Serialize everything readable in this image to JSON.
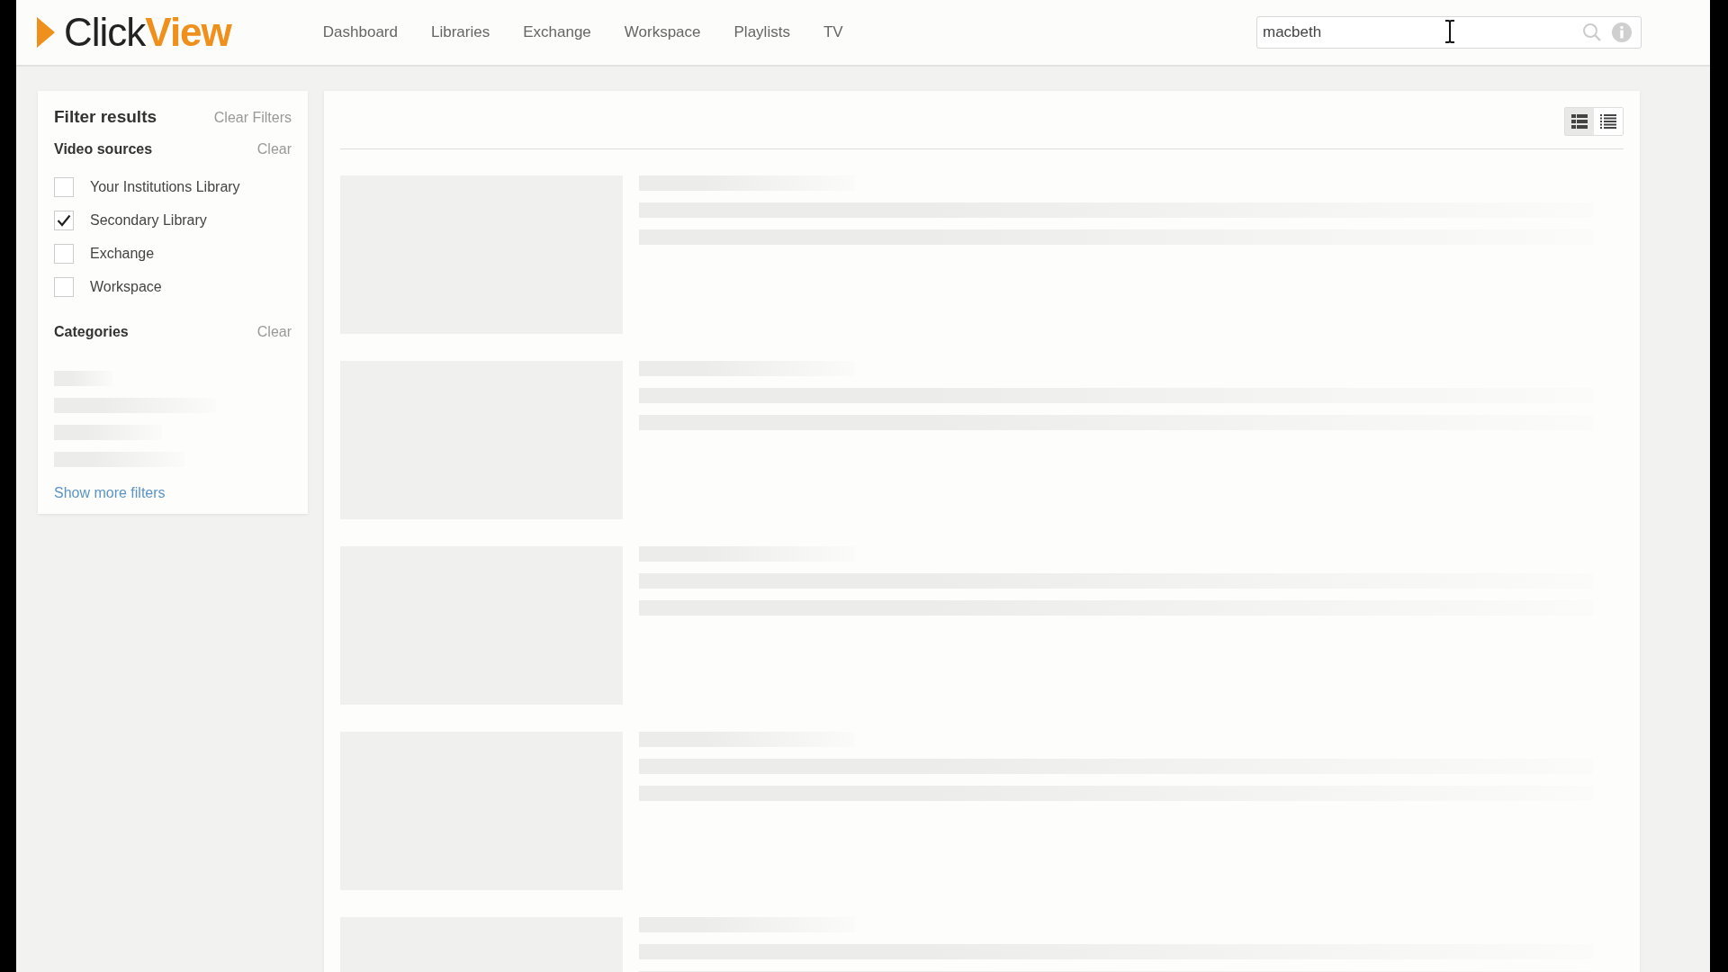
{
  "logo": {
    "first": "Click",
    "second": "View"
  },
  "nav": [
    {
      "label": "Dashboard"
    },
    {
      "label": "Libraries"
    },
    {
      "label": "Exchange"
    },
    {
      "label": "Workspace"
    },
    {
      "label": "Playlists"
    },
    {
      "label": "TV"
    }
  ],
  "search": {
    "value": "macbeth"
  },
  "filters": {
    "title": "Filter results",
    "clear_all": "Clear Filters",
    "video_sources": {
      "heading": "Video sources",
      "clear": "Clear",
      "options": [
        {
          "label": "Your Institutions Library",
          "checked": false
        },
        {
          "label": "Secondary Library",
          "checked": true
        },
        {
          "label": "Exchange",
          "checked": false
        },
        {
          "label": "Workspace",
          "checked": false
        }
      ]
    },
    "categories": {
      "heading": "Categories",
      "clear": "Clear"
    },
    "show_more": "Show more filters"
  },
  "view_toggle": [
    {
      "kind": "detailed",
      "selected": true
    },
    {
      "kind": "compact",
      "selected": false
    }
  ]
}
